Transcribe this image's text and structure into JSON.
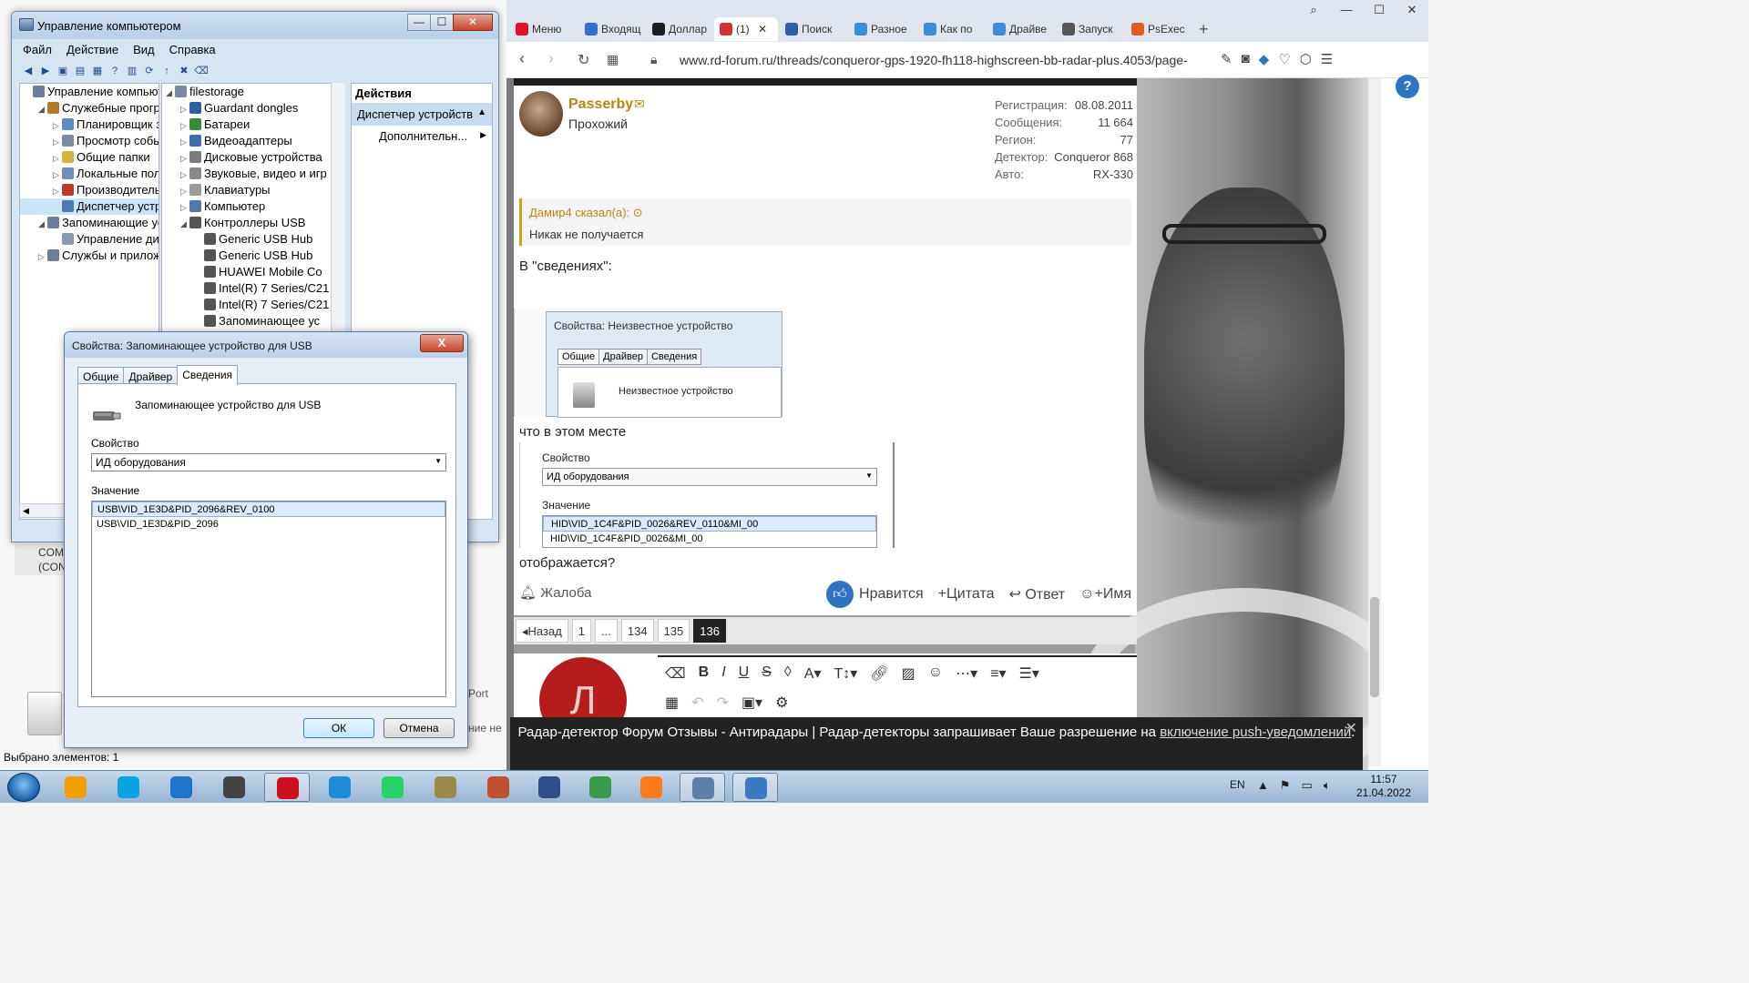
{
  "explorer_bg": {
    "status": "Выбрано элементов: 1",
    "com_label_1": "COM",
    "com_label_2": "(CON",
    "port_label": "Port",
    "nne_label": "ние не"
  },
  "mmc": {
    "title": "Управление компьютером",
    "menu": [
      "Файл",
      "Действие",
      "Вид",
      "Справка"
    ],
    "left_tree": [
      {
        "label": "Управление компьютер",
        "indent": 0,
        "toggle": "",
        "icon_color": "#6b7f99"
      },
      {
        "label": "Служебные програм",
        "indent": 1,
        "toggle": "◢",
        "icon_color": "#b07a28"
      },
      {
        "label": "Планировщик зад",
        "indent": 2,
        "toggle": "▷",
        "icon_color": "#5d8cc4"
      },
      {
        "label": "Просмотр событи",
        "indent": 2,
        "toggle": "▷",
        "icon_color": "#7a8b9e"
      },
      {
        "label": "Общие папки",
        "indent": 2,
        "toggle": "▷",
        "icon_color": "#d9b23d"
      },
      {
        "label": "Локальные польз",
        "indent": 2,
        "toggle": "▷",
        "icon_color": "#6e8fb8"
      },
      {
        "label": "Производительн",
        "indent": 2,
        "toggle": "▷",
        "icon_color": "#c0392b"
      },
      {
        "label": "Диспетчер устрой",
        "indent": 2,
        "toggle": "",
        "icon_color": "#4c7ab0",
        "selected": true
      },
      {
        "label": "Запоминающие устр",
        "indent": 1,
        "toggle": "◢",
        "icon_color": "#6b7f99"
      },
      {
        "label": "Управление диска",
        "indent": 2,
        "toggle": "",
        "icon_color": "#8a9aad"
      },
      {
        "label": "Службы и приложен",
        "indent": 1,
        "toggle": "▷",
        "icon_color": "#6b7f99"
      }
    ],
    "mid_tree": [
      {
        "label": "filestorage",
        "indent": 0,
        "toggle": "◢",
        "icon_color": "#7a8a9c"
      },
      {
        "label": "Guardant dongles",
        "indent": 1,
        "toggle": "▷",
        "icon_color": "#2f5f9c"
      },
      {
        "label": "Батареи",
        "indent": 1,
        "toggle": "▷",
        "icon_color": "#3b8a3b"
      },
      {
        "label": "Видеоадаптеры",
        "indent": 1,
        "toggle": "▷",
        "icon_color": "#3d6fb0"
      },
      {
        "label": "Дисковые устройства",
        "indent": 1,
        "toggle": "▷",
        "icon_color": "#7b7b7b"
      },
      {
        "label": "Звуковые, видео и игр",
        "indent": 1,
        "toggle": "▷",
        "icon_color": "#888888"
      },
      {
        "label": "Клавиатуры",
        "indent": 1,
        "toggle": "▷",
        "icon_color": "#9a9a9a"
      },
      {
        "label": "Компьютер",
        "indent": 1,
        "toggle": "▷",
        "icon_color": "#4f79a8"
      },
      {
        "label": "Контроллеры USB",
        "indent": 1,
        "toggle": "◢",
        "icon_color": "#555555"
      },
      {
        "label": "Generic USB Hub",
        "indent": 2,
        "toggle": "",
        "icon_color": "#555555"
      },
      {
        "label": "Generic USB Hub",
        "indent": 2,
        "toggle": "",
        "icon_color": "#555555"
      },
      {
        "label": "HUAWEI Mobile Co",
        "indent": 2,
        "toggle": "",
        "icon_color": "#555555"
      },
      {
        "label": "Intel(R) 7 Series/C21",
        "indent": 2,
        "toggle": "",
        "icon_color": "#555555"
      },
      {
        "label": "Intel(R) 7 Series/C21",
        "indent": 2,
        "toggle": "",
        "icon_color": "#555555"
      },
      {
        "label": "Запоминающее ус",
        "indent": 2,
        "toggle": "",
        "icon_color": "#555555"
      }
    ],
    "actions_header": "Действия",
    "actions_selected": "Диспетчер устройств",
    "actions_more": "Дополнительн..."
  },
  "dialog": {
    "title": "Свойства: Запоминающее устройство для USB",
    "close": "X",
    "tabs": [
      "Общие",
      "Драйвер",
      "Сведения"
    ],
    "active_tab": 2,
    "device_name": "Запоминающее устройство для USB",
    "property_label": "Свойство",
    "property_value": "ИД оборудования",
    "value_label": "Значение",
    "values": [
      "USB\\VID_1E3D&PID_2096&REV_0100",
      "USB\\VID_1E3D&PID_2096"
    ],
    "ok": "ОК",
    "cancel": "Отмена"
  },
  "browser": {
    "tabs": [
      {
        "label": "Меню",
        "fav_color": "#e0102f"
      },
      {
        "label": "Входящ",
        "fav_color": "#2f6fcf"
      },
      {
        "label": "Доллар",
        "fav_color": "#1d1d1d"
      },
      {
        "label": "(1)",
        "fav_color": "#d32f2f",
        "active": true
      },
      {
        "label": "Поиск",
        "fav_color": "#2d5ea8"
      },
      {
        "label": "Разное",
        "fav_color": "#3d8bd9"
      },
      {
        "label": "Как по",
        "fav_color": "#3d8bd9"
      },
      {
        "label": "Драйве",
        "fav_color": "#3d8bd9"
      },
      {
        "label": "Запуск",
        "fav_color": "#555555"
      },
      {
        "label": "PsExec",
        "fav_color": "#e25c1f"
      }
    ],
    "new_tab": "+",
    "url": "www.rd-forum.ru/threads/conqueror-gps-1920-fh118-highscreen-bb-radar-plus.4053/page-",
    "help": "?"
  },
  "post": {
    "username": "Passerby",
    "role": "Прохожий",
    "stats": [
      {
        "k": "Регистрация:",
        "v": "08.08.2011"
      },
      {
        "k": "Сообщения:",
        "v": "11 664"
      },
      {
        "k": "Регион:",
        "v": "77"
      },
      {
        "k": "Детектор:",
        "v": "Conqueror 868"
      },
      {
        "k": "Авто:",
        "v": "RX-330"
      }
    ],
    "quote_head": "Дамир4 сказал(а):",
    "quote_body": "Никак не получается",
    "text1": "В \"сведениях\":",
    "shot1": {
      "title": "Свойства: Неизвестное устройство",
      "tabs": [
        "Общие",
        "Драйвер",
        "Сведения"
      ],
      "device": "Неизвестное устройство"
    },
    "text2": "что в этом месте",
    "shot2": {
      "prop_label": "Свойство",
      "prop_value": "ИД оборудования",
      "value_label": "Значение",
      "values": [
        "HID\\VID_1C4F&PID_0026&REV_0110&MI_00",
        "HID\\VID_1C4F&PID_0026&MI_00"
      ]
    },
    "text3": "отображается?",
    "complain": "Жалоба",
    "like": "Нравится",
    "quote_btn": "+Цитата",
    "reply_btn": "Ответ",
    "name_btn": "+Имя"
  },
  "pager": {
    "prev": "Назад",
    "pages": [
      "1",
      "...",
      "134",
      "135",
      "136"
    ],
    "current": "136"
  },
  "reply": {
    "avatar_letter": "Л"
  },
  "notify": {
    "text": "Радар-детектор Форум Отзывы - Антирадары | Радар-детекторы запрашивает Ваше разрешение на ",
    "link": "включение push-уведомлений",
    "tail": "."
  },
  "taskbar": {
    "apps": [
      {
        "name": "explorer-app",
        "color": "#f0a000"
      },
      {
        "name": "skype-app",
        "color": "#0aa2e0"
      },
      {
        "name": "ie-app",
        "color": "#1e74c8"
      },
      {
        "name": "solo-app",
        "color": "#444444"
      },
      {
        "name": "opera-app",
        "color": "#cc1020"
      },
      {
        "name": "messenger-app",
        "color": "#1f8ad6"
      },
      {
        "name": "whatsapp-app",
        "color": "#25d366"
      },
      {
        "name": "agent-app",
        "color": "#9a8a4a"
      },
      {
        "name": "tool-app",
        "color": "#c05030"
      },
      {
        "name": "dtv-app",
        "color": "#2e4f8a"
      },
      {
        "name": "qgis-app",
        "color": "#3a9a4a"
      },
      {
        "name": "firefox-app",
        "color": "#ff7a1a"
      },
      {
        "name": "mmc-app",
        "color": "#5d7fa8"
      },
      {
        "name": "remote-app",
        "color": "#3a7ac0"
      }
    ],
    "lang": "EN",
    "time": "11:57",
    "date": "21.04.2022"
  }
}
